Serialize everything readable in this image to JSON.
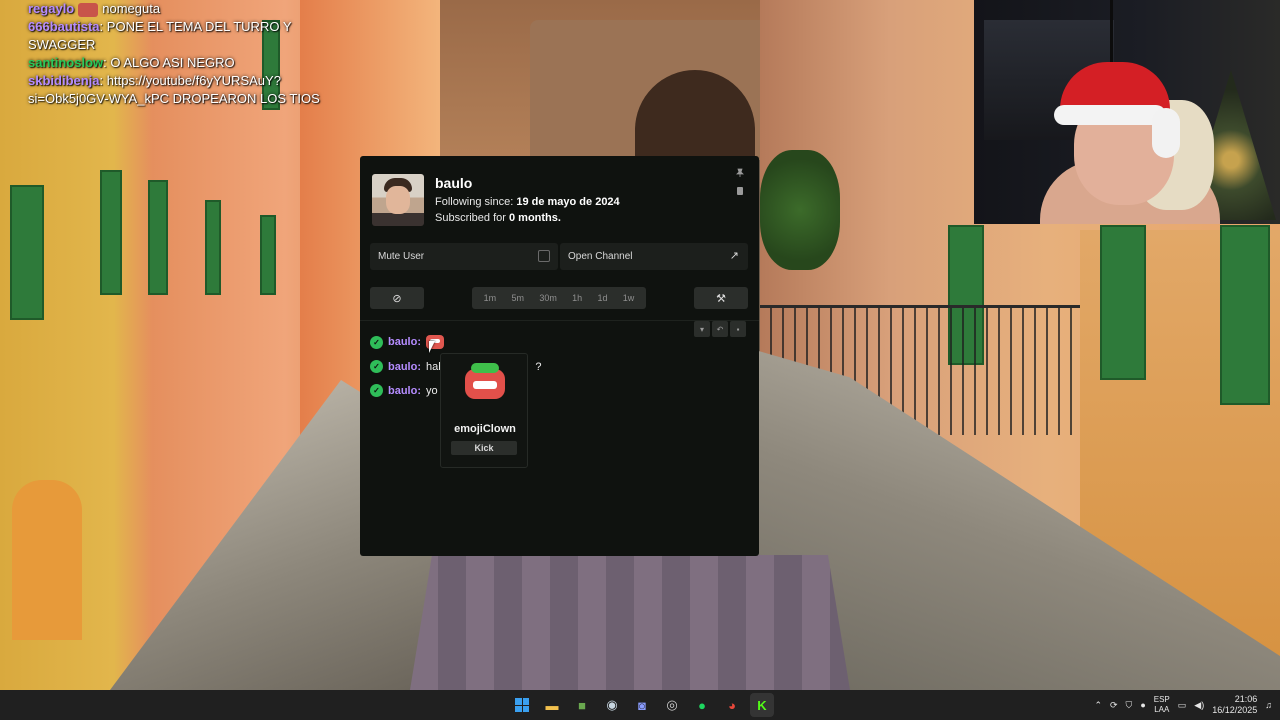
{
  "stream_chat": [
    {
      "user": "regaylo",
      "message": "nomeguta",
      "color": "#b58cff",
      "has_avatar": true
    },
    {
      "user": "666bautista",
      "message": "PONE EL TEMA DEL TURRO Y SWAGGER",
      "color": "#b58cff"
    },
    {
      "user": "santinoslow",
      "message": "O ALGO ASI NEGRO",
      "color": "#28c95b"
    },
    {
      "user": "skbidibenja",
      "message": "https://youtube/f6yYURSAuY?si=Obk5j0GV-WYA_kPC DROPEARON LOS TIOS",
      "color": "#b58cff"
    }
  ],
  "user_card": {
    "username": "baulo",
    "following_label": "Following since:",
    "following_date": "19 de mayo de 2024",
    "subscribed_label": "Subscribed for",
    "subscribed_value": "0 months.",
    "mute_label": "Mute User",
    "open_channel_label": "Open Channel",
    "timeouts": [
      "1m",
      "5m",
      "30m",
      "1h",
      "1d",
      "1w"
    ],
    "messages": [
      {
        "name": "baulo:",
        "text": ""
      },
      {
        "name": "baulo:",
        "text": "hab",
        "trailing": "?"
      },
      {
        "name": "baulo:",
        "text": "yo"
      }
    ],
    "emote_tooltip": {
      "name": "emojiClown",
      "action_label": "Kick"
    }
  },
  "taskbar": {
    "icons": [
      "windows-icon",
      "file-explorer-icon",
      "minecraft-icon",
      "steam-icon",
      "discord-icon",
      "obs-icon",
      "spotify-icon",
      "chrome-icon",
      "kick-icon"
    ],
    "lang_top": "ESP",
    "lang_bottom": "LAA",
    "time": "21:06",
    "date": "16/12/2025"
  },
  "colors": {
    "accent_green": "#2fbd59",
    "username_purple": "#b58cff",
    "card_bg": "#0f120f"
  }
}
